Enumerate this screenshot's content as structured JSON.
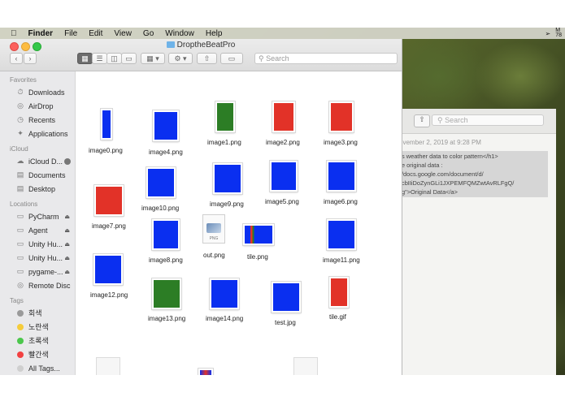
{
  "menubar": {
    "app": "Finder",
    "items": [
      "File",
      "Edit",
      "View",
      "Go",
      "Window",
      "Help"
    ],
    "right_top": "M",
    "right_bottom": "78"
  },
  "window": {
    "title": "DroptheBeatPro",
    "search_placeholder": "Search"
  },
  "sidebar": {
    "favorites_header": "Favorites",
    "favorites": [
      {
        "label": "Downloads",
        "icon": "downloads-icon"
      },
      {
        "label": "AirDrop",
        "icon": "airdrop-icon"
      },
      {
        "label": "Recents",
        "icon": "clock-icon"
      },
      {
        "label": "Applications",
        "icon": "applications-icon"
      }
    ],
    "icloud_header": "iCloud",
    "icloud": [
      {
        "label": "iCloud D...",
        "icon": "cloud-icon"
      },
      {
        "label": "Documents",
        "icon": "document-icon"
      },
      {
        "label": "Desktop",
        "icon": "desktop-icon"
      }
    ],
    "locations_header": "Locations",
    "locations": [
      {
        "label": "PyCharm",
        "icon": "disk-icon"
      },
      {
        "label": "Agent",
        "icon": "disk-icon"
      },
      {
        "label": "Unity Hu...",
        "icon": "disk-icon"
      },
      {
        "label": "Unity Hu...",
        "icon": "disk-icon"
      },
      {
        "label": "pygame-...",
        "icon": "disk-icon"
      },
      {
        "label": "Remote Disc",
        "icon": "disc-icon"
      }
    ],
    "tags_header": "Tags",
    "tags": [
      {
        "label": "회색",
        "color": "#9a9a9a"
      },
      {
        "label": "노란색",
        "color": "#f5cc3b"
      },
      {
        "label": "초록색",
        "color": "#4cc74c"
      },
      {
        "label": "빨간색",
        "color": "#f24141"
      },
      {
        "label": "All Tags...",
        "color": "#cfcfcf"
      }
    ]
  },
  "files": [
    {
      "name": "image0.png",
      "color": "#0a2ff0"
    },
    {
      "name": "image4.png",
      "color": "#0a2ff0"
    },
    {
      "name": "image1.png",
      "color": "#2c7d25"
    },
    {
      "name": "image2.png",
      "color": "#e23228"
    },
    {
      "name": "image3.png",
      "color": "#e23228"
    },
    {
      "name": "image10.png",
      "color": "#0a2ff0"
    },
    {
      "name": "image9.png",
      "color": "#0a2ff0"
    },
    {
      "name": "image5.png",
      "color": "#0a2ff0"
    },
    {
      "name": "image6.png",
      "color": "#0a2ff0"
    },
    {
      "name": "image7.png",
      "color": "#e23228"
    },
    {
      "name": "out.png",
      "badge": "PNG"
    },
    {
      "name": "image8.png",
      "color": "#0a2ff0"
    },
    {
      "name": "tile.png",
      "color": "#0a2ff0"
    },
    {
      "name": "image11.png",
      "color": "#0a2ff0"
    },
    {
      "name": "image12.png",
      "color": "#0a2ff0"
    },
    {
      "name": "image13.png",
      "color": "#2c7d25"
    },
    {
      "name": "image14.png",
      "color": "#0a2ff0"
    },
    {
      "name": "test.jpg",
      "color": "#0a2ff0"
    },
    {
      "name": "tile.gif",
      "color": "#e23228"
    }
  ],
  "background_editor": {
    "search_placeholder": "Search",
    "date": "ovember 2, 2019 at 9:28 PM",
    "selected_lines": [
      "s weather data to color pattern</h1>",
      "e original data :",
      "/docs.google.com/document/d/",
      "cbIIiDoZynGLi1JXPEMFQMZwtAvRLFgQ/",
      "g\">Original Data</a>"
    ]
  }
}
